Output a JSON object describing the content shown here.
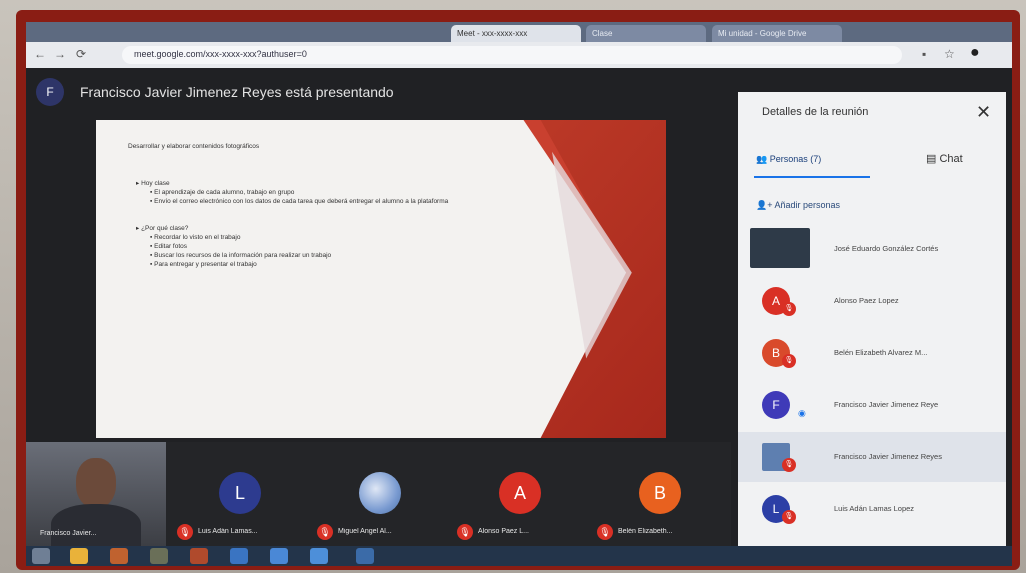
{
  "browser": {
    "tabs": [
      "Meet - xxx-xxxx-xxx",
      "Clase",
      "Mi unidad - Google Drive"
    ],
    "url": "meet.google.com/xxx-xxxx-xxx?authuser=0"
  },
  "meet": {
    "presenter": {
      "initial": "F",
      "text": "Francisco Javier Jimenez Reyes está presentando"
    },
    "slide": {
      "title": "Desarrollar y elaborar contenidos fotográficos",
      "section1": "Hoy clase",
      "section1_items": [
        "El aprendizaje de cada alumno, trabajo en grupo",
        "Envío el correo electrónico con los datos de cada tarea que deberá entregar el alumno a la plataforma"
      ],
      "section2": "¿Por qué clase?",
      "section2_items": [
        "Recordar lo visto en el trabajo",
        "Editar fotos",
        "Buscar los recursos de la información para realizar un trabajo",
        "Para entregar y presentar el trabajo"
      ]
    },
    "filmstrip": {
      "self_label": "Francisco Javier...",
      "participants": [
        {
          "initial": "L",
          "name": "Luis Adán Lamas...",
          "color": "#2d3b8f"
        },
        {
          "initial": "",
          "name": "Miguel Angel Al...",
          "color": "#7a9bd1"
        },
        {
          "initial": "A",
          "name": "Alonso Paez L...",
          "color": "#d93025"
        },
        {
          "initial": "B",
          "name": "Belén Elizabeth...",
          "color": "#e8611f"
        }
      ],
      "mic_glyph": "̸"
    }
  },
  "panel": {
    "title": "Detalles de la reunión",
    "close_glyph": "✕",
    "tab_people": "Personas (7)",
    "tab_chat": "Chat",
    "add_people": "Añadir personas",
    "people": [
      {
        "initial": "",
        "name": "José Eduardo González Cortés",
        "color": "#3a4148"
      },
      {
        "initial": "A",
        "name": "Alonso Paez Lopez",
        "color": "#d93025"
      },
      {
        "initial": "B",
        "name": "Belén Elizabeth Alvarez M...",
        "color": "#d94a2b"
      },
      {
        "initial": "F",
        "name": "Francisco Javier Jimenez Reye",
        "color": "#3f3ab8"
      },
      {
        "initial": "",
        "name": "Francisco Javier Jimenez Reyes",
        "color": "#5e7fb0"
      },
      {
        "initial": "L",
        "name": "Luis Adán Lamas Lopez",
        "color": "#2c3fa6"
      }
    ]
  }
}
